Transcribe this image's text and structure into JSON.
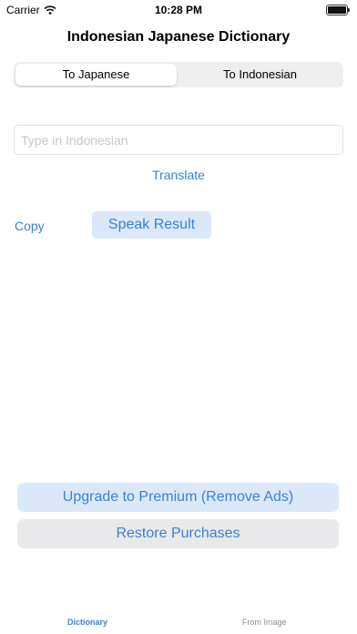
{
  "status_bar": {
    "carrier": "Carrier",
    "time": "10:28 PM"
  },
  "header": {
    "title": "Indonesian Japanese Dictionary"
  },
  "direction_tabs": [
    {
      "label": "To Japanese",
      "selected": true
    },
    {
      "label": "To Indonesian",
      "selected": false
    }
  ],
  "input": {
    "placeholder": "Type in Indonesian",
    "value": ""
  },
  "actions": {
    "translate": "Translate",
    "copy": "Copy",
    "speak": "Speak Result"
  },
  "purchase": {
    "upgrade": "Upgrade to Premium (Remove Ads)",
    "restore": "Restore Purchases"
  },
  "bottom_tabs": [
    {
      "label": "Dictionary",
      "active": true
    },
    {
      "label": "From Image",
      "active": false
    }
  ],
  "colors": {
    "accent": "#3b82d0",
    "accent_bg": "#dbe8f9",
    "gray_bg": "#e9e9eb"
  }
}
